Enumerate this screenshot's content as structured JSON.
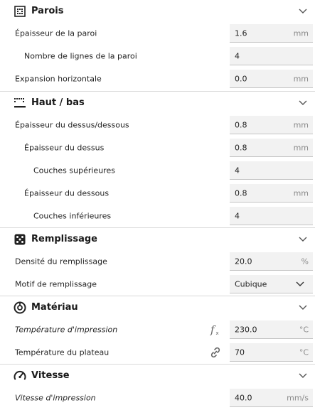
{
  "sections": {
    "walls": {
      "title": "Parois",
      "rows": [
        {
          "label": "Épaisseur de la paroi",
          "value": "1.6",
          "unit": "mm"
        },
        {
          "label": "Nombre de lignes de la paroi",
          "value": "4",
          "unit": ""
        },
        {
          "label": "Expansion horizontale",
          "value": "0.0",
          "unit": "mm"
        }
      ]
    },
    "topbottom": {
      "title": "Haut / bas",
      "rows": [
        {
          "label": "Épaisseur du dessus/dessous",
          "value": "0.8",
          "unit": "mm"
        },
        {
          "label": "Épaisseur du dessus",
          "value": "0.8",
          "unit": "mm"
        },
        {
          "label": "Couches supérieures",
          "value": "4",
          "unit": ""
        },
        {
          "label": "Épaisseur du dessous",
          "value": "0.8",
          "unit": "mm"
        },
        {
          "label": "Couches inférieures",
          "value": "4",
          "unit": ""
        }
      ]
    },
    "infill": {
      "title": "Remplissage",
      "rows": [
        {
          "label": "Densité du remplissage",
          "value": "20.0",
          "unit": "%"
        },
        {
          "label": "Motif de remplissage",
          "value": "Cubique",
          "unit": ""
        }
      ]
    },
    "material": {
      "title": "Matériau",
      "rows": [
        {
          "label": "Température d'impression",
          "value": "230.0",
          "unit": "°C"
        },
        {
          "label": "Température du plateau",
          "value": "70",
          "unit": "°C"
        }
      ]
    },
    "speed": {
      "title": "Vitesse",
      "rows": [
        {
          "label": "Vitesse d'impression",
          "value": "40.0",
          "unit": "mm/s"
        }
      ]
    }
  },
  "icons": {
    "walls": "walls-icon",
    "topbottom": "top-bottom-icon",
    "infill": "infill-icon",
    "material": "material-icon",
    "speed": "speed-icon",
    "formula": "formula-icon",
    "link": "link-icon",
    "chevron": "chevron-down-icon"
  }
}
